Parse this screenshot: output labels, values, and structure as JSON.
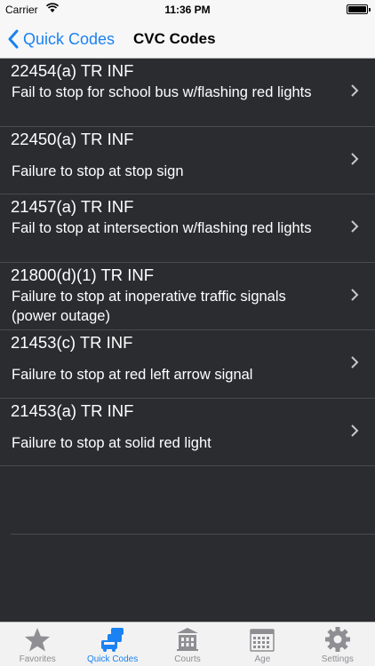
{
  "status_bar": {
    "carrier": "Carrier",
    "time": "11:36 PM"
  },
  "nav": {
    "back_label": "Quick Codes",
    "title": "CVC Codes"
  },
  "rows": [
    {
      "code": "22454(a) TR INF",
      "description": "Fail to stop for school bus w/flashing red lights"
    },
    {
      "code": "22450(a) TR INF",
      "description": "Failure to stop at stop sign"
    },
    {
      "code": "21457(a) TR INF",
      "description": "Fail to stop at intersection w/flashing red lights"
    },
    {
      "code": "21800(d)(1) TR INF",
      "description": "Failure to stop at inoperative traffic signals (power outage)"
    },
    {
      "code": "21453(c) TR INF",
      "description": "Failure to stop at red left arrow signal"
    },
    {
      "code": "21453(a) TR INF",
      "description": "Failure to stop at solid red light"
    }
  ],
  "tabs": [
    {
      "label": "Favorites",
      "icon": "star-icon",
      "active": false
    },
    {
      "label": "Quick Codes",
      "icon": "cars-icon",
      "active": true
    },
    {
      "label": "Courts",
      "icon": "courthouse-icon",
      "active": false
    },
    {
      "label": "Age",
      "icon": "calendar-icon",
      "active": false
    },
    {
      "label": "Settings",
      "icon": "gear-icon",
      "active": false
    }
  ],
  "colors": {
    "accent": "#1a82f2",
    "list_background": "#2b2c30",
    "bar_background": "#f7f7f7"
  }
}
